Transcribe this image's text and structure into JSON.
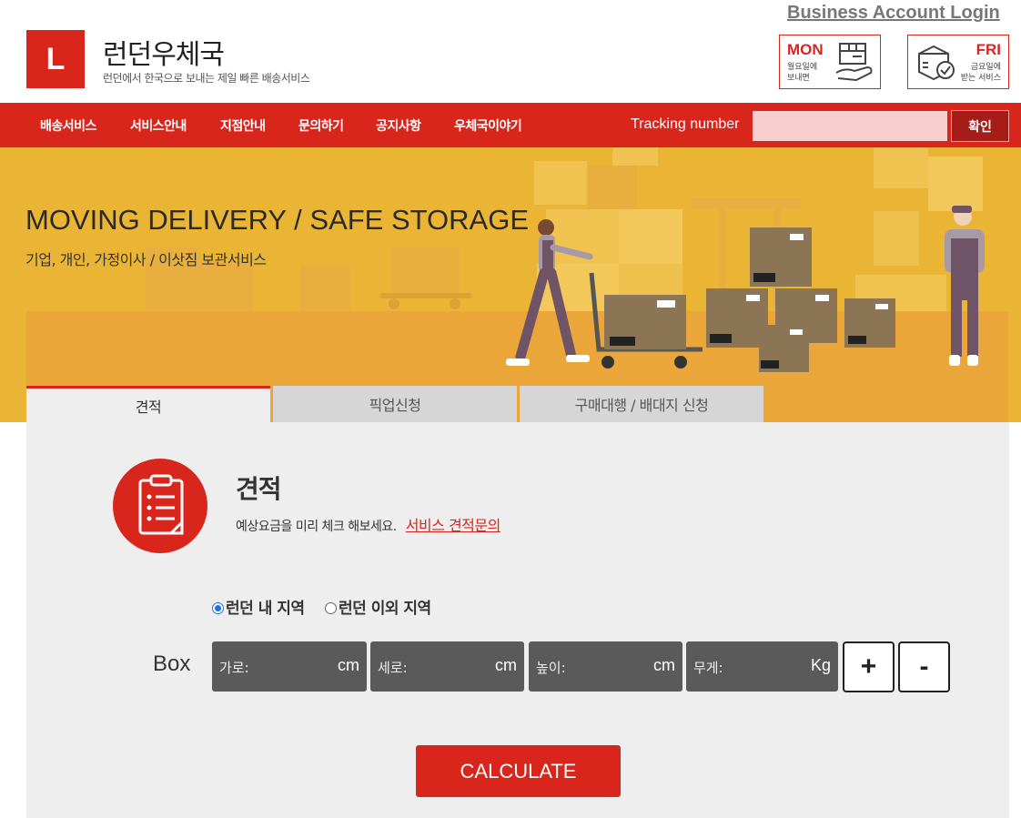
{
  "header": {
    "business_login": "Business Account Login",
    "logo_letter": "L",
    "brand_name": "런던우체국",
    "brand_tagline": "런던에서 한국으로 보내는 제일 빠른 배송서비스",
    "promo_mon": {
      "day": "MON",
      "line1": "월요일에",
      "line2": "보내면"
    },
    "promo_fri": {
      "day": "FRI",
      "line1": "금요일에",
      "line2": "받는 서비스"
    }
  },
  "nav": {
    "items": [
      "배송서비스",
      "서비스안내",
      "지점안내",
      "문의하기",
      "공지사항",
      "우체국이야기"
    ],
    "tracking_label": "Tracking number",
    "tracking_value": "",
    "confirm_label": "확인"
  },
  "hero": {
    "title": "MOVING DELIVERY / SAFE STORAGE",
    "subtitle": "기업, 개인, 가정이사 / 이삿짐 보관서비스"
  },
  "tabs": [
    {
      "label": "견적",
      "active": true
    },
    {
      "label": "픽업신청",
      "active": false
    },
    {
      "label": "구매대행 / 배대지 신청",
      "active": false
    }
  ],
  "quote": {
    "title": "견적",
    "description": "예상요금을 미리 체크 해보세요.",
    "link_label": "서비스 견적문의"
  },
  "region": {
    "options": [
      {
        "label": "런던 내 지역",
        "checked": true
      },
      {
        "label": "런던 이외 지역",
        "checked": false
      }
    ]
  },
  "box": {
    "label": "Box",
    "fields": [
      {
        "label": "가로:",
        "unit": "cm",
        "value": ""
      },
      {
        "label": "세로:",
        "unit": "cm",
        "value": ""
      },
      {
        "label": "높이:",
        "unit": "cm",
        "value": ""
      },
      {
        "label": "무게:",
        "unit": "Kg",
        "value": ""
      }
    ],
    "add_label": "+",
    "remove_label": "-"
  },
  "calculate_label": "CALCULATE",
  "colors": {
    "brand_red": "#d8261d",
    "hero_yellow": "#eab535",
    "dark_red": "#a61c16"
  }
}
